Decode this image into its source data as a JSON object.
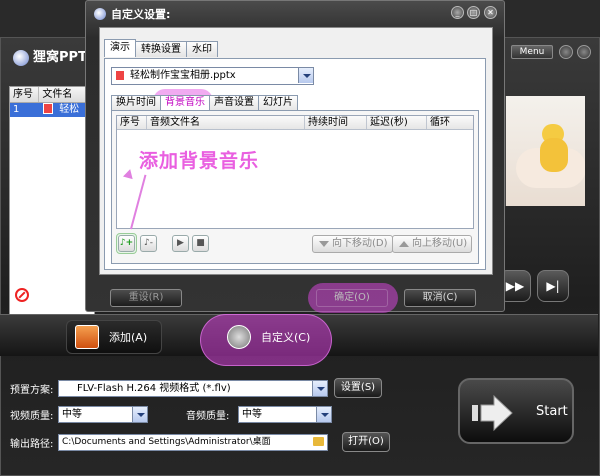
{
  "app": {
    "title": "狸窝PPT转",
    "menu_label": "Menu",
    "file_list": {
      "columns": [
        "序号",
        "文件名"
      ],
      "rows": [
        {
          "index": "1",
          "name": "轻松"
        }
      ]
    },
    "remove_label": "移除(",
    "add_button_label": "添加(A)",
    "custom_button_label": "自定义(C)",
    "preset_label": "预置方案:",
    "preset_value": "FLV-Flash H.264 视频格式 (*.flv)",
    "settings_button": "设置(S)",
    "video_quality_label": "视频质量:",
    "video_quality_value": "中等",
    "audio_quality_label": "音频质量:",
    "audio_quality_value": "中等",
    "output_label": "输出路径:",
    "output_value": "C:\\Documents and Settings\\Administrator\\桌面",
    "open_button": "打开(O)",
    "start_label": "Start"
  },
  "dialog": {
    "title": "自定义设置:",
    "tabs": [
      "演示",
      "转换设置",
      "水印"
    ],
    "active_tab": "演示",
    "file_select_value": "轻松制作宝宝相册.pptx",
    "subtabs": [
      "换片时间",
      "背景音乐",
      "声音设置",
      "幻灯片"
    ],
    "active_subtab": "背景音乐",
    "music_table_columns": [
      "序号",
      "音频文件名",
      "持续时间",
      "延迟(秒)",
      "循环"
    ],
    "hint_text": "添加背景音乐",
    "move_down_label": "向下移动(D)",
    "move_up_label": "向上移动(U)",
    "reset_label": "重设(R)",
    "ok_label": "确定(O)",
    "cancel_label": "取消(C)"
  },
  "colors": {
    "highlight": "#d04ad5",
    "hint": "#e95fe0",
    "selection": "#3a6fd8"
  }
}
